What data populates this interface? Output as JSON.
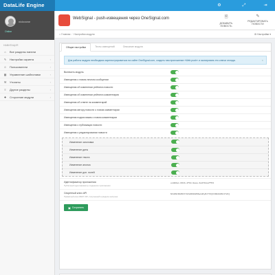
{
  "app": {
    "brand": "DataLife Engine"
  },
  "topbar": {
    "icons": [
      "gear-icon",
      "expand-icon",
      "signout-icon"
    ]
  },
  "sidebar": {
    "user_name": "nickname",
    "user_status": "Online",
    "section_header": "навигация",
    "items": [
      {
        "label": "Все разделы панели",
        "icon": "home-icon",
        "arrow": false
      },
      {
        "label": "Настройки скрипта",
        "icon": "wrench-icon",
        "arrow": true
      },
      {
        "label": "Пользователи",
        "icon": "users-icon",
        "arrow": true
      },
      {
        "label": "Управление шаблонами",
        "icon": "template-icon",
        "arrow": true
      },
      {
        "label": "Утилиты",
        "icon": "tools-icon",
        "arrow": true
      },
      {
        "label": "Другие разделы",
        "icon": "list-icon",
        "arrow": true
      },
      {
        "label": "Сторонние модули",
        "icon": "puzzle-icon",
        "arrow": true
      }
    ]
  },
  "page": {
    "title": "WebSignal - push-извещения через OneSignal.com",
    "actions": [
      {
        "label": "ДОБАВИТЬ НОВОСТЬ",
        "icon": "file-add-icon"
      },
      {
        "label": "РЕДАКТИРОВАТЬ НОВОСТИ",
        "icon": "file-edit-icon"
      }
    ]
  },
  "breadcrumb": {
    "home": "Главная",
    "current": "Настройки модуля",
    "settings": "Настройки"
  },
  "tabs": [
    "Общие настройки",
    "Тесты извещений",
    "Описание модуля"
  ],
  "alert": {
    "text": "Для работы модуля необходимо зарегистрироваться на сайте OneSignal.com, создать там приложение «Web push» и скопировать его ключи отсюда."
  },
  "settings": [
    {
      "label": "Включить модуль",
      "on": true
    },
    {
      "label": "Извещения о новом личном сообщении",
      "on": true
    },
    {
      "label": "Извещения об изменении рейтинга новости",
      "on": true
    },
    {
      "label": "Извещения об изменении рейтинга комментария",
      "on": true
    },
    {
      "label": "Извещения об ответе на комментарий",
      "on": true
    },
    {
      "label": "Извещения автору новости о новом комментарии",
      "on": true
    },
    {
      "label": "Извещения подписчикам о новом комментарии",
      "on": true
    },
    {
      "label": "Извещения о публикации новости",
      "on": true
    },
    {
      "label": "Извещения о редактировании новости",
      "on": true
    }
  ],
  "sub_settings": [
    {
      "label": "Изменение заголовка",
      "on": true
    },
    {
      "label": "Изменение даты",
      "on": true
    },
    {
      "label": "Изменение текста",
      "on": true
    },
    {
      "label": "Изменение анонса",
      "on": true
    },
    {
      "label": "Изменение доп. полей",
      "on": true
    }
  ],
  "app_id": {
    "label": "Идентификатор приложения",
    "hint": "Публичный идентификатор созданного приложения",
    "value": "ecd86ac-661b-4fb4-9aea-3a4744eaff63"
  },
  "api_key": {
    "label": "Секретный ключ API",
    "hint": "Приватный ключ REST API, полученный в разделе настроек",
    "value": "NzU2NzRkZDItYmVmNC00ZDIwLWIyNzYtNjhhNGI2ZDc1Y2Fj"
  },
  "save_label": "Сохранить",
  "colors": {
    "topbar": "#2a9cdd",
    "brand_bg": "#1d7ab5",
    "toggle_on": "#4caf50",
    "save_button": "#2e9b5c",
    "alert_bg": "#dff0f9"
  }
}
